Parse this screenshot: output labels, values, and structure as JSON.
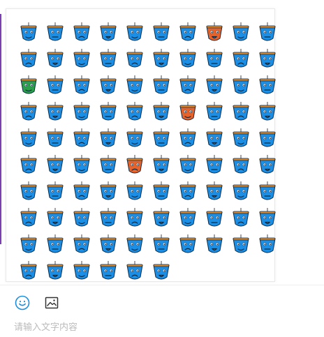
{
  "emoji_panel": {
    "item_count": 96,
    "icon": "blue-bucket-face-emoji",
    "face_color": "#1b8fe6",
    "rim_color": "#e08a2c",
    "accent_colors": [
      "#e8632a",
      "#2aa04a"
    ]
  },
  "toolbar": {
    "emoji_button_icon": "smiley-icon",
    "image_button_icon": "image-icon",
    "accent_color": "#1a8fe0"
  },
  "composer": {
    "placeholder": "请输入文字内容"
  }
}
